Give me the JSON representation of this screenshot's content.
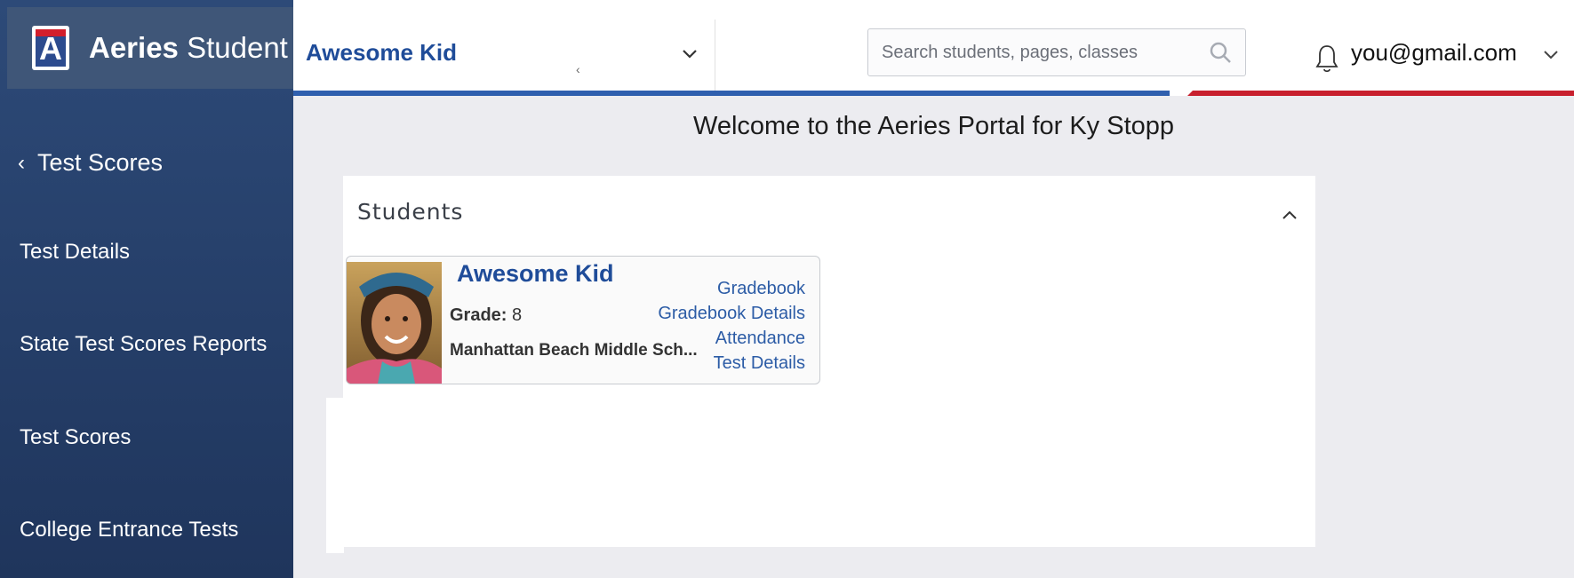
{
  "brand": {
    "name_bold": "Aeries",
    "name_light": "Student",
    "logo_letter": "A"
  },
  "sidebar": {
    "back_label": "Test Scores",
    "items": [
      {
        "label": "Test Details"
      },
      {
        "label": "State Test Scores Reports"
      },
      {
        "label": "Test Scores"
      },
      {
        "label": "College Entrance Tests"
      }
    ]
  },
  "header": {
    "student_name": "Awesome Kid",
    "tiny_mark": "‹",
    "search_placeholder": "Search students, pages, classes",
    "user_email": "you@gmail.com"
  },
  "main": {
    "welcome": "Welcome to the Aeries Portal for Ky Stopp",
    "card_title": "Students",
    "student_card": {
      "name": "Awesome Kid",
      "grade_label": "Grade:",
      "grade_value": "8",
      "school": "Manhattan Beach Middle Sch...",
      "links": [
        "Gradebook",
        "Gradebook Details",
        "Attendance",
        "Test Details"
      ]
    }
  },
  "colors": {
    "sidebar_top": "#2d4a78",
    "sidebar_bottom": "#1f355c",
    "accent_blue": "#2f5fae",
    "accent_red": "#c8202e",
    "link": "#2c5ca6"
  },
  "icons": [
    "search-icon",
    "bell-icon",
    "chevron-down-icon",
    "chevron-left-icon",
    "chevron-up-icon"
  ]
}
